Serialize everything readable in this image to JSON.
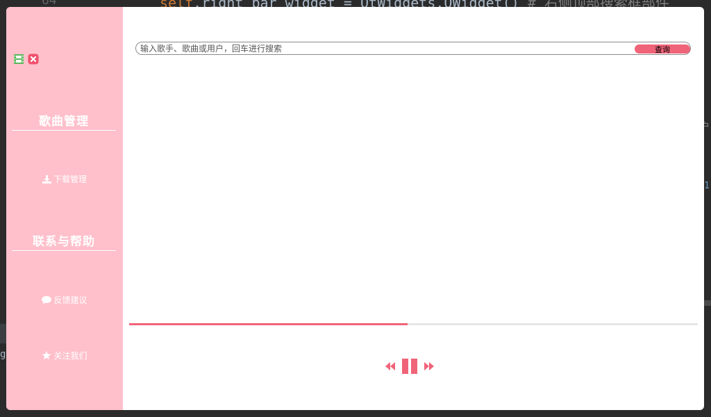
{
  "background_editor": {
    "line_number": "64",
    "code_kw": "self",
    "code_text": ".right_bar_widget = QtWidgets.QWidget()",
    "code_comment": "# 右侧顶部搜索框部件",
    "side_right_1": "户",
    "side_right_2": "1",
    "side_left": "g"
  },
  "window_controls": {
    "restore_icon": "film-icon",
    "close_icon": "close-icon",
    "restore_color": "#5cb85c",
    "close_color": "#f0506e"
  },
  "sidebar": {
    "section_song_management": "歌曲管理",
    "item_download": "下载管理",
    "section_contact_help": "联系与帮助",
    "item_feedback": "反馈建议",
    "item_follow": "关注我们"
  },
  "search": {
    "placeholder": "输入歌手、歌曲或用户，回车进行搜索",
    "button_label": "查询"
  },
  "player": {
    "progress_fraction": 0.49,
    "accent_color": "#f06479",
    "icons": [
      "backward-icon",
      "pause-icon",
      "forward-icon"
    ]
  },
  "colors": {
    "sidebar_bg": "#ffc0cb",
    "accent": "#f06479"
  }
}
